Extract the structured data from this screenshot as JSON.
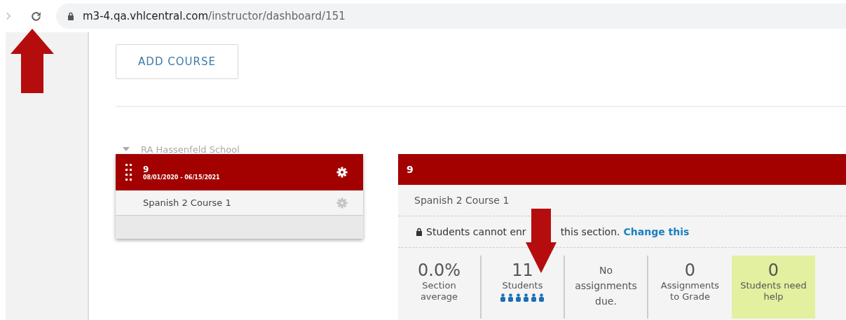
{
  "browser": {
    "url_host": "m3-4.qa.vhlcentral.com",
    "url_path": "/instructor/dashboard/151"
  },
  "add_course_button": "ADD COURSE",
  "school": {
    "name": "RA Hassenfeld School",
    "expanded": true
  },
  "section_card": {
    "title": "9",
    "dates": "08/01/2020 - 06/15/2021",
    "courses": [
      {
        "name": "Spanish 2 Course 1"
      }
    ]
  },
  "section_panel": {
    "title": "9",
    "course": "Spanish 2 Course 1",
    "notice_parts": [
      "Students cannot enr",
      "this section."
    ],
    "notice_link": "Change this",
    "stats": [
      {
        "kind": "number",
        "value": "0.0%",
        "label": "Section average",
        "highlight": false
      },
      {
        "kind": "students",
        "value": "11",
        "label": "Students",
        "highlight": false
      },
      {
        "kind": "message",
        "label": "No assignments due.",
        "highlight": false
      },
      {
        "kind": "number",
        "value": "0",
        "label": "Assignments to Grade",
        "highlight": false
      },
      {
        "kind": "number",
        "value": "0",
        "label": "Students need help",
        "highlight": true
      }
    ]
  }
}
